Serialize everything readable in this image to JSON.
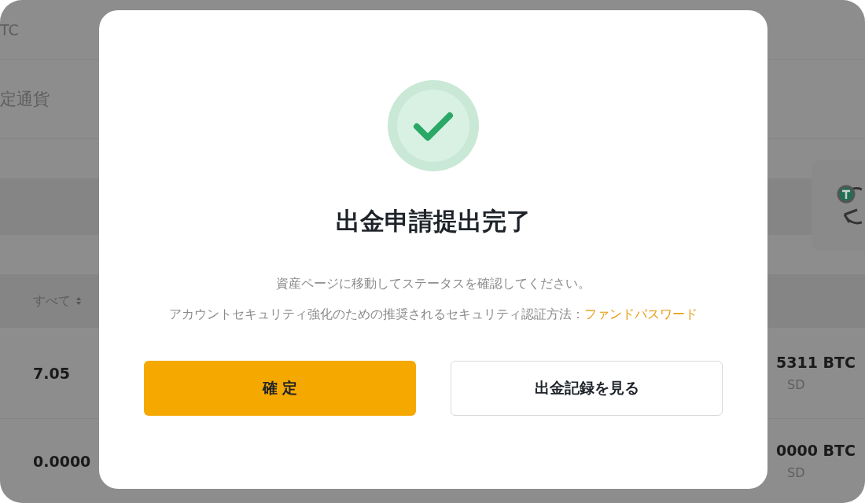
{
  "background": {
    "unit": "TC",
    "currency_label": "定通貨",
    "filter": {
      "label": "すべて"
    },
    "rows": [
      {
        "amount": "7.05",
        "balance": "5311 BTC",
        "sub": "SD"
      },
      {
        "amount": "0.0000",
        "balance": "0000 BTC",
        "sub": "SD"
      }
    ]
  },
  "dialog": {
    "title": "出金申請提出完了",
    "message": "資産ページに移動してステータスを確認してください。",
    "hint": "アカウントセキュリティ強化のための推奨されるセキュリティ認証方法：",
    "link": "ファンドパスワード",
    "buttons": [
      {
        "label": "確 定",
        "kind": "primary"
      },
      {
        "label": "出金記録を見る",
        "kind": "secondary"
      }
    ]
  }
}
